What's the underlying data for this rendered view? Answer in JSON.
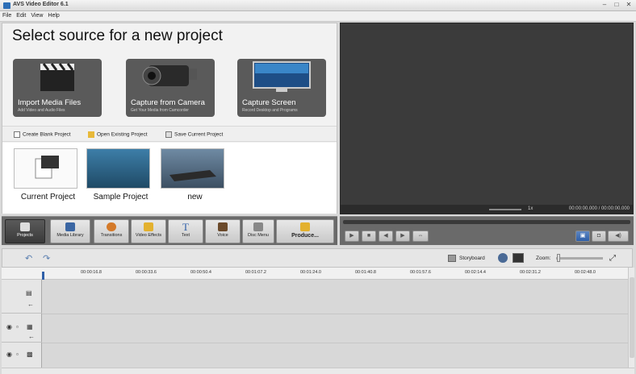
{
  "window": {
    "title": "AVS Video Editor 6.1"
  },
  "menu": [
    "File",
    "Edit",
    "View",
    "Help"
  ],
  "source": {
    "title": "Select source for a new project",
    "cards": [
      {
        "label": "Import Media Files",
        "sub": "Add Video and Audio Files"
      },
      {
        "label": "Capture from Camera",
        "sub": "Get Your Media from Camcorder"
      },
      {
        "label": "Capture Screen",
        "sub": "Record Desktop and Programs"
      }
    ],
    "quick": [
      "Create Blank Project",
      "Open Existing Project",
      "Save Current Project"
    ],
    "projects": [
      "Current Project",
      "Sample Project",
      "new"
    ]
  },
  "preview": {
    "speed": "1x",
    "time": "00:00:00.000 / 00:00:00.000"
  },
  "toolbar": [
    "Projects",
    "Media Library",
    "Transitions",
    "Video Effects",
    "Text",
    "Voice",
    "Disc Menu",
    "Produce..."
  ],
  "timeline": {
    "storyboard_label": "Storyboard",
    "zoom_label": "Zoom:",
    "ticks": [
      "00:00:16.8",
      "00:00:33.6",
      "00:00:50.4",
      "00:01:07.2",
      "00:01:24.0",
      "00:01:40.8",
      "00:01:57.6",
      "00:02:14.4",
      "00:02:31.2",
      "00:02:48.0"
    ]
  },
  "colors": {
    "accent": "#2f5fa8",
    "panel_dark": "#6a6a6a",
    "preview_bg": "#3b3b3b"
  }
}
